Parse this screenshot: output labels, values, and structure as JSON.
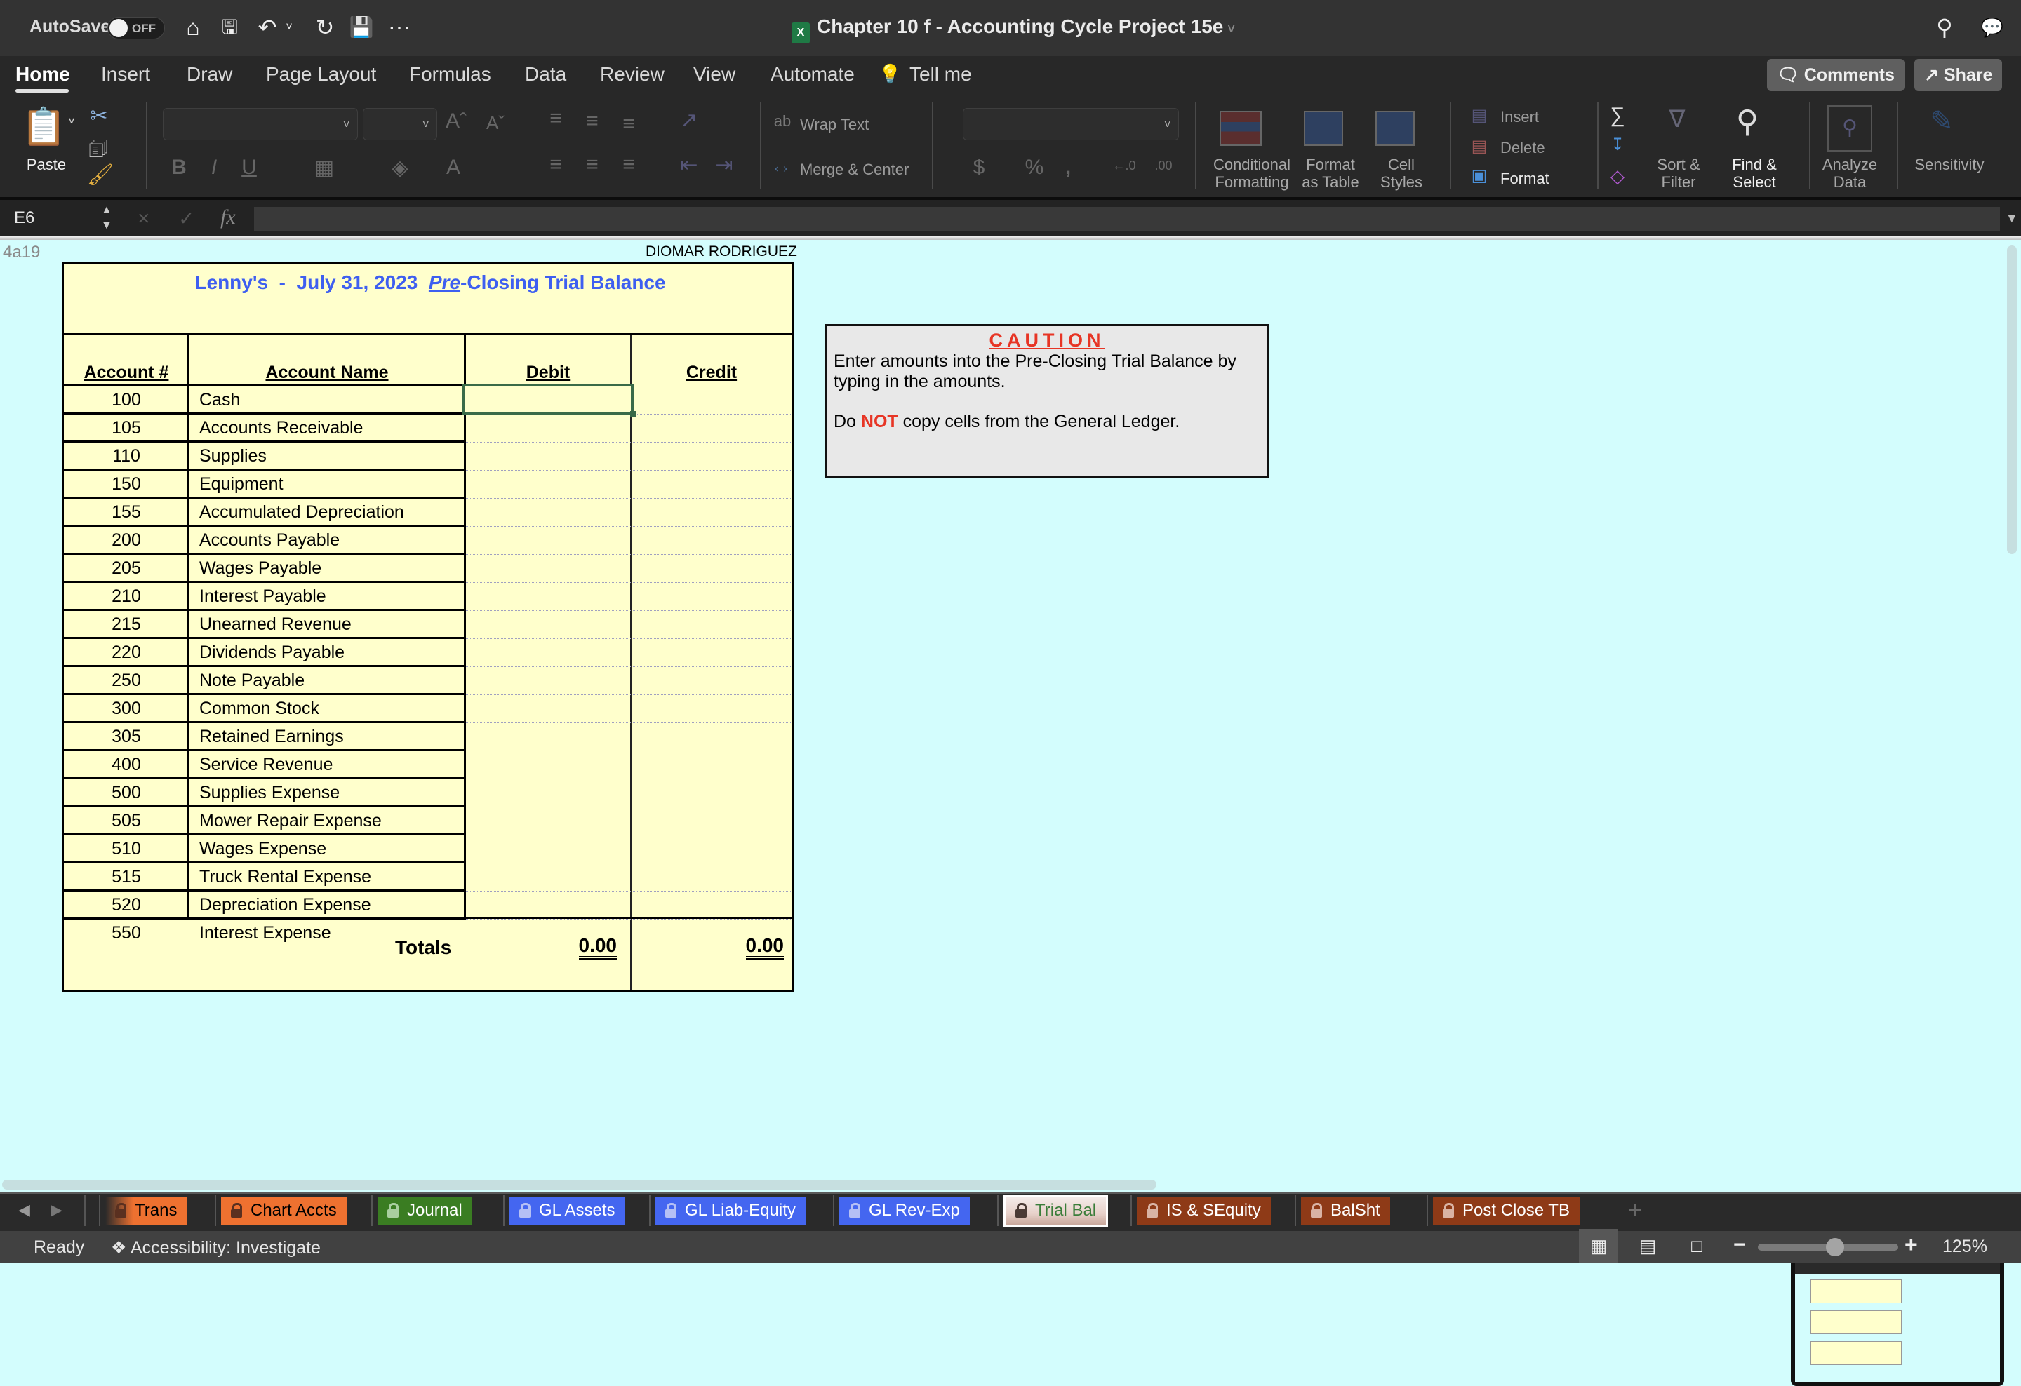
{
  "titlebar": {
    "autosave_label": "AutoSave",
    "autosave_state": "OFF",
    "document_title": "Chapter 10 f - Accounting Cycle Project 15e",
    "quick_access": [
      "home-icon",
      "save-as-icon",
      "undo-icon",
      "redo-icon",
      "save-icon",
      "more-icon"
    ]
  },
  "menu": {
    "tabs": [
      "Home",
      "Insert",
      "Draw",
      "Page Layout",
      "Formulas",
      "Data",
      "Review",
      "View",
      "Automate",
      "Tell me"
    ],
    "active_tab": "Home",
    "comments_label": "Comments",
    "share_label": "Share"
  },
  "ribbon": {
    "paste_label": "Paste",
    "font_name": "",
    "font_size": "",
    "wrap_text_label": "Wrap Text",
    "merge_center_label": "Merge & Center",
    "number_format": "",
    "conditional_formatting_label": "Conditional\nFormatting",
    "format_as_table_label": "Format\nas Table",
    "cell_styles_label": "Cell\nStyles",
    "insert_label": "Insert",
    "delete_label": "Delete",
    "format_label": "Format",
    "sort_filter_label": "Sort &\nFilter",
    "find_select_label": "Find &\nSelect",
    "analyze_data_label": "Analyze\nData",
    "sensitivity_label": "Sensitivity"
  },
  "formula_bar": {
    "name_box": "E6",
    "fx_label": "fx",
    "formula": ""
  },
  "sheet": {
    "cell_ref_note": "4a19",
    "author": "DIOMAR RODRIGUEZ",
    "title_before": "Lenny's  -  July 31, 2023  ",
    "title_pre": "Pre",
    "title_after": "-Closing Trial Balance",
    "headers": {
      "account_num": "Account #",
      "account_name": "Account Name",
      "debit": "Debit",
      "credit": "Credit"
    },
    "accounts": [
      {
        "num": "100",
        "name": "Cash",
        "debit": "",
        "credit": ""
      },
      {
        "num": "105",
        "name": "Accounts Receivable",
        "debit": "",
        "credit": ""
      },
      {
        "num": "110",
        "name": "Supplies",
        "debit": "",
        "credit": ""
      },
      {
        "num": "150",
        "name": "Equipment",
        "debit": "",
        "credit": ""
      },
      {
        "num": "155",
        "name": "Accumulated Depreciation",
        "debit": "",
        "credit": ""
      },
      {
        "num": "200",
        "name": "Accounts Payable",
        "debit": "",
        "credit": ""
      },
      {
        "num": "205",
        "name": "Wages Payable",
        "debit": "",
        "credit": ""
      },
      {
        "num": "210",
        "name": "Interest Payable",
        "debit": "",
        "credit": ""
      },
      {
        "num": "215",
        "name": "Unearned Revenue",
        "debit": "",
        "credit": ""
      },
      {
        "num": "220",
        "name": "Dividends Payable",
        "debit": "",
        "credit": ""
      },
      {
        "num": "250",
        "name": "Note Payable",
        "debit": "",
        "credit": ""
      },
      {
        "num": "300",
        "name": "Common Stock",
        "debit": "",
        "credit": ""
      },
      {
        "num": "305",
        "name": "Retained Earnings",
        "debit": "",
        "credit": ""
      },
      {
        "num": "400",
        "name": "Service Revenue",
        "debit": "",
        "credit": ""
      },
      {
        "num": "500",
        "name": "Supplies Expense",
        "debit": "",
        "credit": ""
      },
      {
        "num": "505",
        "name": "Mower Repair Expense",
        "debit": "",
        "credit": ""
      },
      {
        "num": "510",
        "name": "Wages Expense",
        "debit": "",
        "credit": ""
      },
      {
        "num": "515",
        "name": "Truck Rental Expense",
        "debit": "",
        "credit": ""
      },
      {
        "num": "520",
        "name": "Depreciation Expense",
        "debit": "",
        "credit": ""
      },
      {
        "num": "550",
        "name": "Interest Expense",
        "debit": "",
        "credit": ""
      }
    ],
    "totals_label": "Totals",
    "total_debit": "0.00",
    "total_credit": "0.00",
    "selected_cell": "E6",
    "caution": {
      "title": "CAUTION",
      "line1": "Enter amounts into the Pre-Closing Trial Balance by typing in the amounts.",
      "line2_before": "Do ",
      "line2_emph": "NOT",
      "line2_after": " copy cells from the General Ledger."
    }
  },
  "sheet_tabs": [
    {
      "label": "Trans",
      "bg": "#ee7130",
      "fg": "#000000",
      "lock": "#5a3020"
    },
    {
      "label": "Chart Accts",
      "bg": "#ee7130",
      "fg": "#000000",
      "lock": "#5a3020"
    },
    {
      "label": "Journal",
      "bg": "#3a7d22",
      "fg": "#ffffff",
      "lock": "#a9cfa0"
    },
    {
      "label": "GL Assets",
      "bg": "#4466f0",
      "fg": "#ffffff",
      "lock": "#b5c0f5"
    },
    {
      "label": "GL Liab-Equity",
      "bg": "#4466f0",
      "fg": "#ffffff",
      "lock": "#b5c0f5"
    },
    {
      "label": "GL Rev-Exp",
      "bg": "#4466f0",
      "fg": "#ffffff",
      "lock": "#b5c0f5"
    },
    {
      "label": "Trial Bal",
      "bg": "#e8d2cb",
      "fg": "#3a7d3a",
      "lock": "#4a3a35",
      "active": true
    },
    {
      "label": "IS & SEquity",
      "bg": "#8e3a17",
      "fg": "#ffffff",
      "lock": "#d9b3a4"
    },
    {
      "label": "BalSht",
      "bg": "#8e3a17",
      "fg": "#ffffff",
      "lock": "#d9b3a4"
    },
    {
      "label": "Post Close TB",
      "bg": "#8e3a17",
      "fg": "#ffffff",
      "lock": "#d9b3a4"
    }
  ],
  "status": {
    "ready": "Ready",
    "accessibility": "Accessibility: Investigate",
    "zoom": "125%",
    "zoom_fraction": 0.55
  }
}
